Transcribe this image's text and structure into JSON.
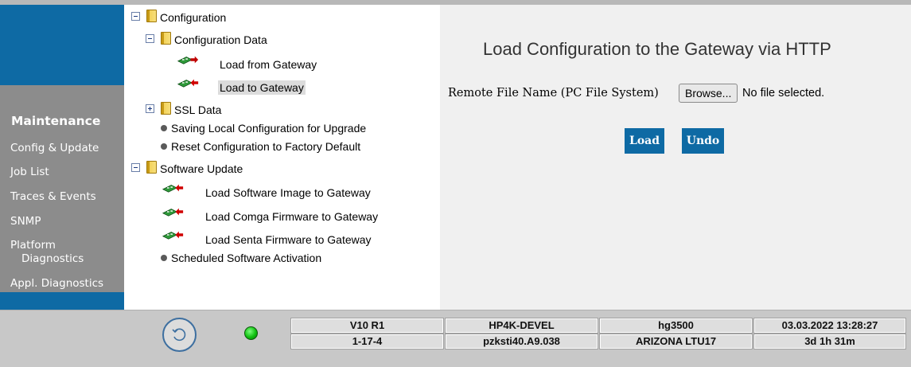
{
  "sidebar": {
    "heading": "Maintenance",
    "items": [
      {
        "label": "Config & Update"
      },
      {
        "label": "Job List"
      },
      {
        "label": "Traces & Events"
      },
      {
        "label": "SNMP"
      },
      {
        "label": "Platform",
        "label2": "Diagnostics"
      },
      {
        "label": "Appl. Diagnostics"
      }
    ]
  },
  "tree": {
    "configuration": "Configuration",
    "configuration_data": "Configuration Data",
    "load_from_gateway": "Load from Gateway",
    "load_to_gateway": "Load to Gateway",
    "ssl_data": "SSL Data",
    "saving_local": "Saving Local Configuration for Upgrade",
    "reset_factory": "Reset Configuration to Factory Default",
    "software_update": "Software Update",
    "load_sw_image": "Load Software Image to Gateway",
    "load_comga": "Load Comga Firmware to Gateway",
    "load_senta": "Load Senta Firmware to Gateway",
    "scheduled_activation": "Scheduled Software Activation"
  },
  "main": {
    "title": "Load Configuration to the Gateway via HTTP",
    "file_label": "Remote File Name (PC File System)",
    "browse_label": "Browse...",
    "no_file": "No file selected.",
    "load_label": "Load",
    "undo_label": "Undo"
  },
  "footer": {
    "row1": [
      "V10 R1",
      "HP4K-DEVEL",
      "hg3500",
      "03.03.2022 13:28:27"
    ],
    "row2": [
      "1-17-4",
      "pzksti40.A9.038",
      "ARIZONA LTU17",
      "3d 1h 31m"
    ]
  },
  "colors": {
    "accent": "#0e6aa4",
    "sidebar": "#8c8c8c",
    "footer": "#c8c8c8",
    "led": "#10c010"
  },
  "icons": [
    "folder-icon",
    "expander-minus-icon",
    "expander-plus-icon",
    "gateway-board-icon",
    "arrow-out-icon",
    "arrow-in-icon",
    "bullet-icon",
    "refresh-icon",
    "status-led-icon"
  ]
}
